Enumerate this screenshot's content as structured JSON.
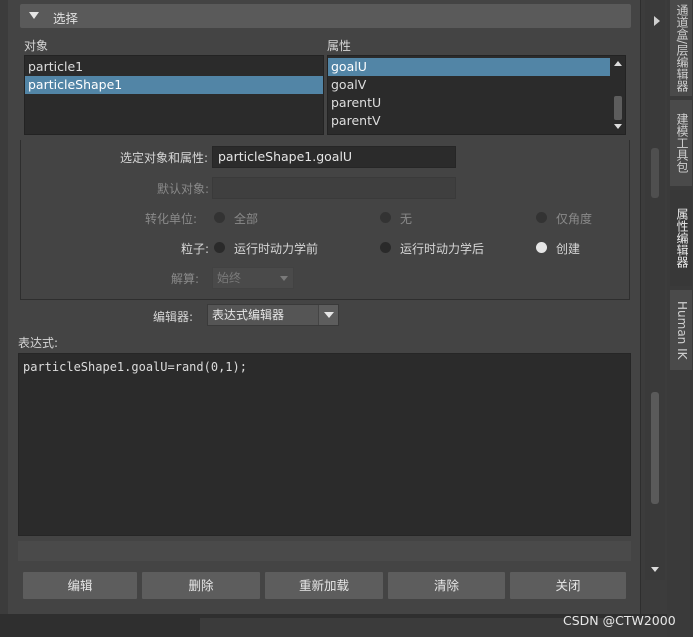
{
  "section": {
    "title": "选择"
  },
  "objects": {
    "label": "对象",
    "items": [
      "particle1",
      "particleShape1"
    ],
    "selected_index": 1
  },
  "attributes": {
    "label": "属性",
    "items": [
      "goalU",
      "goalV",
      "parentU",
      "parentV"
    ],
    "selected_index": 0
  },
  "form": {
    "selected_label": "选定对象和属性:",
    "selected_value": "particleShape1.goalU",
    "default_label": "默认对象:",
    "default_value": "",
    "units_label": "转化单位:",
    "units_options": [
      "全部",
      "无",
      "仅角度"
    ],
    "particle_label": "粒子:",
    "particle_options": [
      "运行时动力学前",
      "运行时动力学后",
      "创建"
    ],
    "particle_selected": "创建",
    "eval_label": "解算:",
    "eval_value": "始终"
  },
  "editor": {
    "label": "编辑器:",
    "value": "表达式编辑器"
  },
  "expression": {
    "label": "表达式:",
    "code": "particleShape1.goalU=rand(0,1);"
  },
  "buttons": {
    "edit": "编辑",
    "delete": "删除",
    "reload": "重新加载",
    "clear": "清除",
    "close": "关闭"
  },
  "side_tabs": [
    "通道盒/层编辑器",
    "建模工具包",
    "属性编辑器",
    "Human IK"
  ],
  "side_tab_active": 2,
  "watermark": "CSDN @CTW2000",
  "colors": {
    "selection": "#5285a6",
    "panel": "#444444",
    "field": "#2b2b2b"
  }
}
